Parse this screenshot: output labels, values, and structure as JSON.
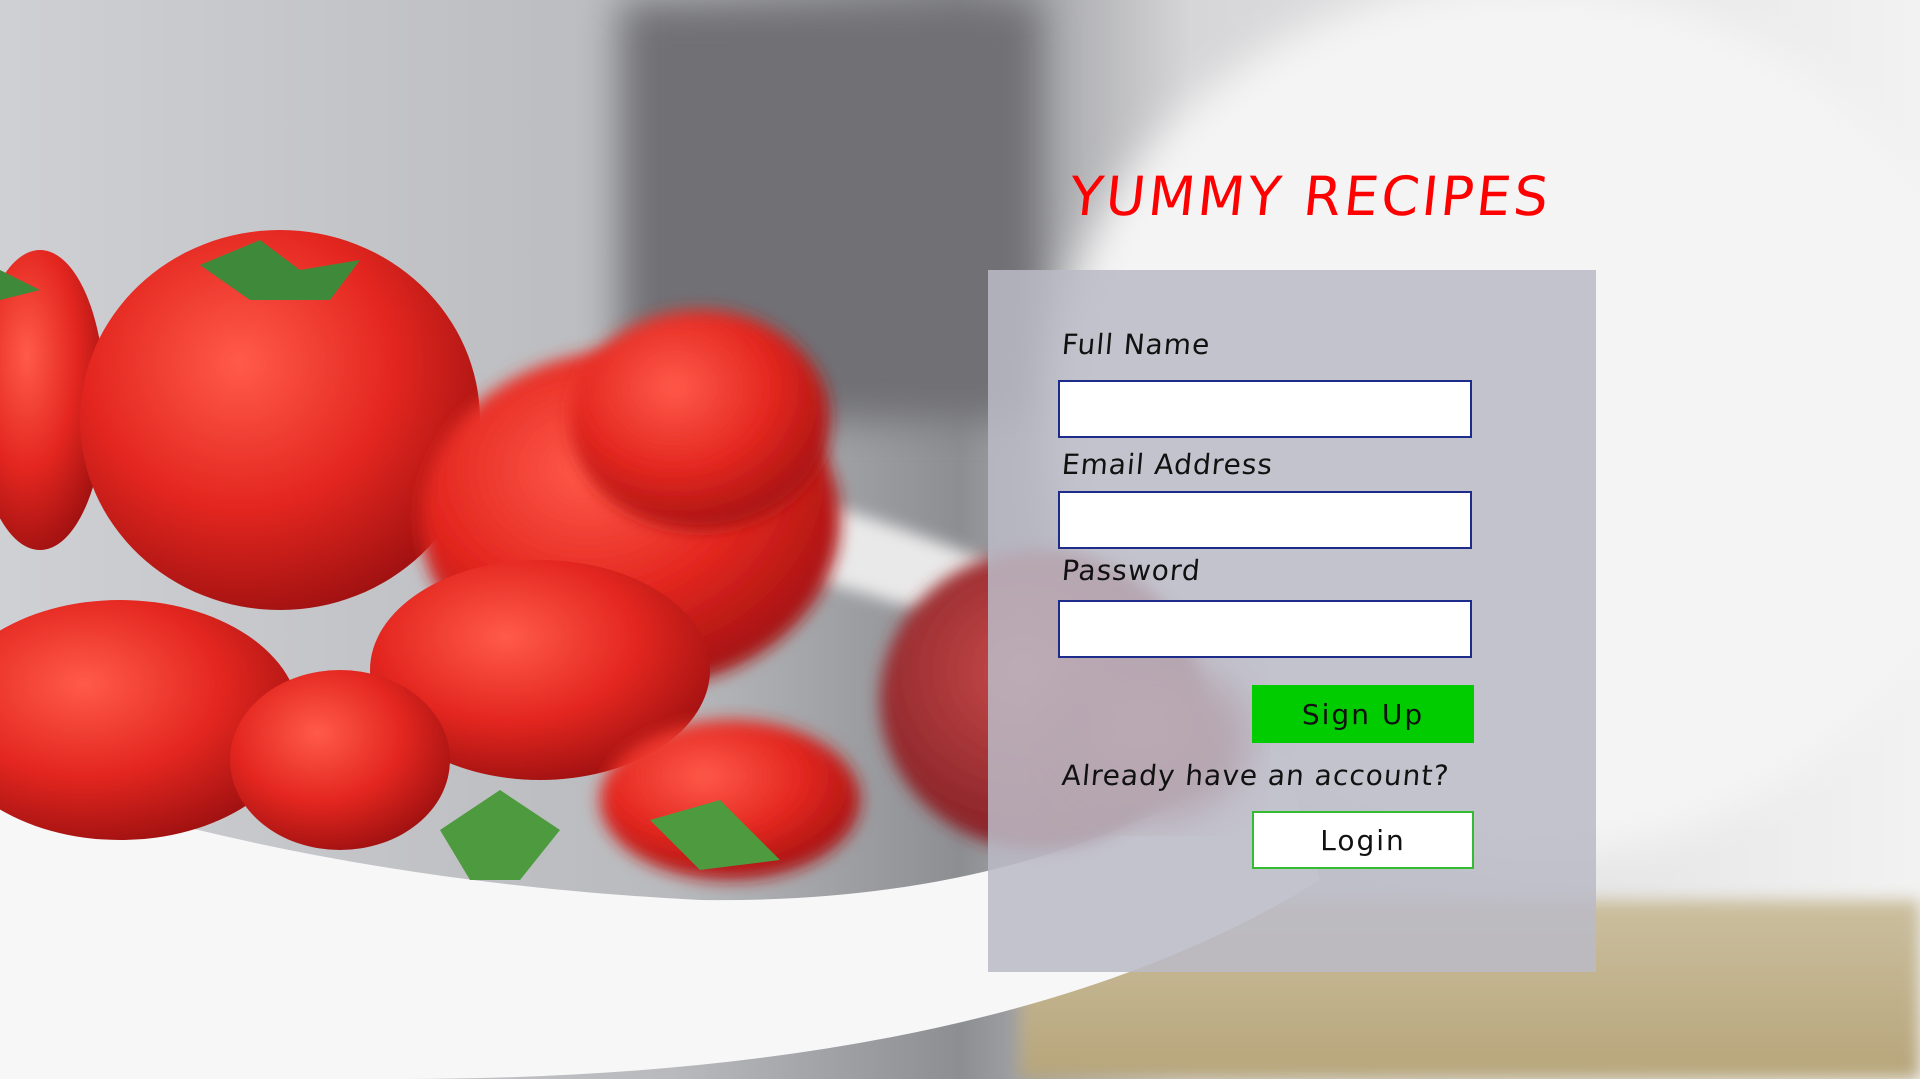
{
  "app": {
    "title": "YUMMY RECIPES"
  },
  "form": {
    "full_name": {
      "label": "Full Name",
      "value": "",
      "placeholder": ""
    },
    "email": {
      "label": "Email Address",
      "value": "",
      "placeholder": ""
    },
    "password": {
      "label": "Password",
      "value": "",
      "placeholder": ""
    },
    "signup_label": "Sign Up",
    "account_prompt": "Already have an account?",
    "login_label": "Login"
  },
  "colors": {
    "title": "#ff0000",
    "signup_button": "#00cc00",
    "login_button": "#ffffff",
    "login_border": "#33bb33",
    "input_border": "#1d2b8a",
    "panel": "#babac6"
  },
  "background": {
    "subject": "bowl of strawberries"
  }
}
